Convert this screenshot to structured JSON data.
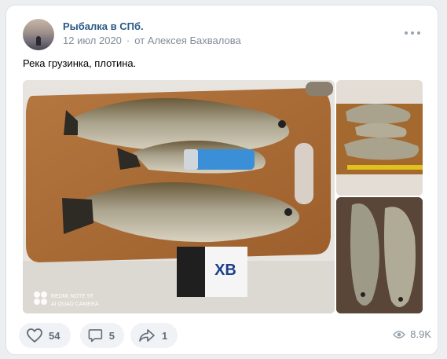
{
  "post": {
    "group_name": "Рыбалка в СПб.",
    "date": "12 июл 2020",
    "author": "от Алексея Бахвалова",
    "text": "Река грузинка, плотина."
  },
  "media": {
    "watermark_line1": "REDMI NOTE 9T",
    "watermark_line2": "AI QUAD CAMERA",
    "package_text": "ХВ"
  },
  "actions": {
    "likes": "54",
    "comments": "5",
    "shares": "1",
    "views": "8.9K"
  },
  "colors": {
    "link": "#2a5885",
    "secondary_text": "#818c99",
    "pill_bg": "#f0f2f5",
    "icon": "#626d7a"
  },
  "icons": [
    "more-horizontal-icon",
    "heart-icon",
    "comment-icon",
    "share-arrow-icon",
    "eye-icon"
  ]
}
